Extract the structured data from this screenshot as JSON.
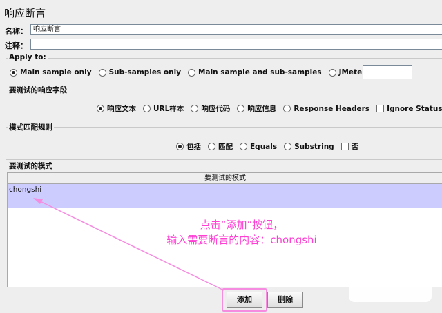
{
  "title": "响应断言",
  "name_field": {
    "label": "名称：",
    "value": "响应断言"
  },
  "comment_field": {
    "label": "注释：",
    "value": ""
  },
  "apply_to": {
    "title": "Apply to:",
    "options": [
      "Main sample only",
      "Sub-samples only",
      "Main sample and sub-samples",
      "JMeter Variable"
    ],
    "selected": "Main sample only",
    "variable_value": ""
  },
  "response_field": {
    "title": "要测试的响应字段",
    "options": [
      "响应文本",
      "URL样本",
      "响应代码",
      "响应信息",
      "Response Headers"
    ],
    "selected": "响应文本",
    "ignore_status": "Ignore Status"
  },
  "pattern_rules": {
    "title": "模式匹配规则",
    "options": [
      "包括",
      "匹配",
      "Equals",
      "Substring"
    ],
    "selected": "包括",
    "not_label": "否"
  },
  "patterns": {
    "title": "要测试的模式",
    "column_header": "要测试的模式",
    "rows": [
      "chongshi"
    ]
  },
  "buttons": {
    "add": "添加",
    "delete": "删除"
  },
  "annotation": {
    "line1": "点击“添加”按钮，",
    "line2": "输入需要断言的内容：chongshi"
  },
  "colors": {
    "annotation": "#ff3fd4",
    "selected_row": "#ccccff",
    "background": "#eeeeee"
  }
}
